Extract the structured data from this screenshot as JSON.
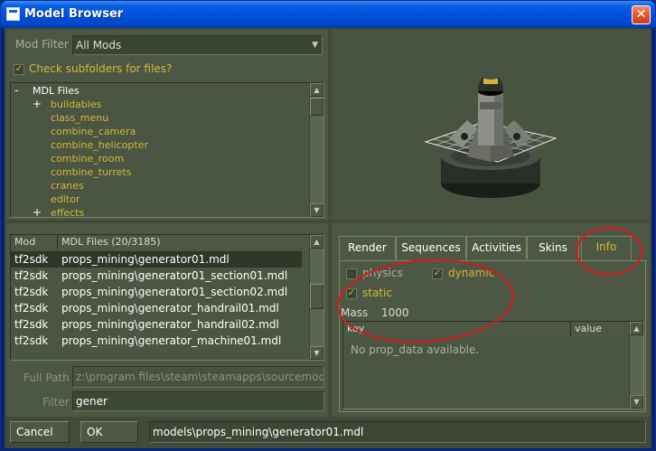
{
  "window": {
    "title": "Model Browser",
    "close_glyph": "✕"
  },
  "mod_filter": {
    "label": "Mod Filter",
    "value": "All Mods"
  },
  "check_subfolders": {
    "label": "Check subfolders for files?",
    "checked": true
  },
  "tree": {
    "root_label": "MDL Files",
    "items": [
      {
        "label": "buildables",
        "expander": "+"
      },
      {
        "label": "class_menu",
        "expander": ""
      },
      {
        "label": "combine_camera",
        "expander": ""
      },
      {
        "label": "combine_helicopter",
        "expander": ""
      },
      {
        "label": "combine_room",
        "expander": ""
      },
      {
        "label": "combine_turrets",
        "expander": ""
      },
      {
        "label": "cranes",
        "expander": ""
      },
      {
        "label": "editor",
        "expander": ""
      },
      {
        "label": "effects",
        "expander": "+"
      }
    ]
  },
  "file_list": {
    "columns": [
      "Mod",
      "MDL Files (20/3185)"
    ],
    "rows": [
      {
        "mod": "tf2sdk",
        "file": "props_mining\\generator01.mdl",
        "selected": true
      },
      {
        "mod": "tf2sdk",
        "file": "props_mining\\generator01_section01.mdl",
        "selected": false
      },
      {
        "mod": "tf2sdk",
        "file": "props_mining\\generator01_section02.mdl",
        "selected": false
      },
      {
        "mod": "tf2sdk",
        "file": "props_mining\\generator_handrail01.mdl",
        "selected": false
      },
      {
        "mod": "tf2sdk",
        "file": "props_mining\\generator_handrail02.mdl",
        "selected": false
      },
      {
        "mod": "tf2sdk",
        "file": "props_mining\\generator_machine01.mdl",
        "selected": false
      }
    ]
  },
  "full_path": {
    "label": "Full Path",
    "value": "z:\\program files\\steam\\steamapps\\sourcemods"
  },
  "filter": {
    "label": "Filter",
    "value": "gener"
  },
  "buttons": {
    "cancel": "Cancel",
    "ok": "OK"
  },
  "model_path": "models\\props_mining\\generator01.mdl",
  "tabs": [
    "Render",
    "Sequences",
    "Activities",
    "Skins",
    "Info"
  ],
  "active_tab": "Info",
  "info": {
    "physics_label": "physics",
    "dynamic_label": "dynamic",
    "static_label": "static",
    "mass_label": "Mass",
    "mass_value": "1000",
    "table_columns": [
      "key",
      "value"
    ],
    "empty_message": "No prop_data available."
  },
  "colors": {
    "accent_yellow": "#d6b43a",
    "panel_bg": "#4c5844",
    "annotation_red": "#e0141a"
  },
  "icons": {
    "close": "close-icon",
    "scroll_up": "arrow-up-icon",
    "scroll_down": "arrow-down-icon",
    "check": "check-icon",
    "dropdown": "chevron-down-icon"
  }
}
